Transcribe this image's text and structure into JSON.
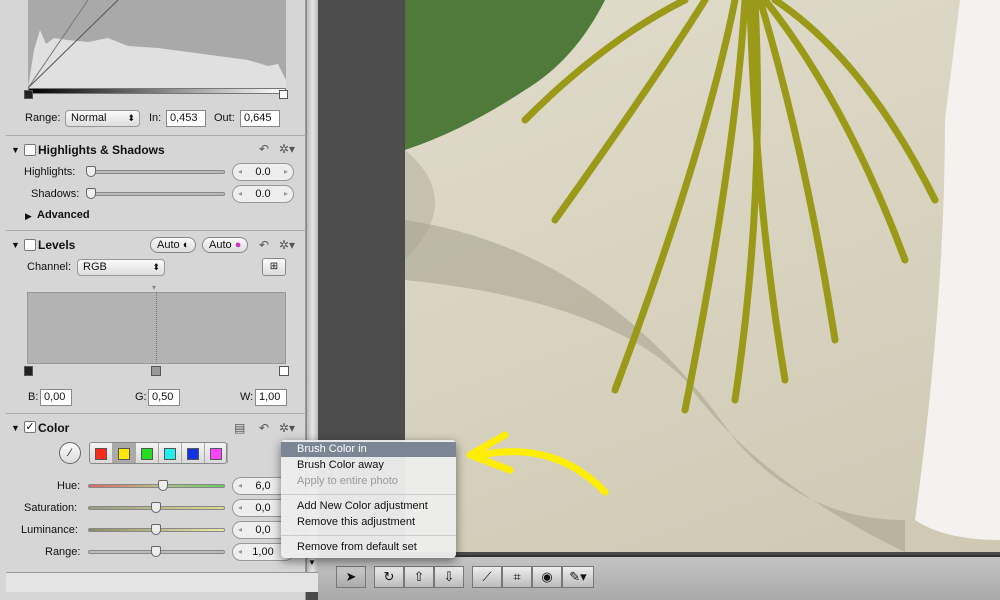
{
  "curves": {
    "range_label": "Range:",
    "range_value": "Normal",
    "in_label": "In:",
    "in_value": "0,453",
    "out_label": "Out:",
    "out_value": "0,645"
  },
  "highlights_shadows": {
    "title": "Highlights & Shadows",
    "enabled": false,
    "highlights_label": "Highlights:",
    "highlights_value": "0.0",
    "shadows_label": "Shadows:",
    "shadows_value": "0.0",
    "advanced_label": "Advanced"
  },
  "levels": {
    "title": "Levels",
    "enabled": false,
    "auto1": "Auto",
    "auto2": "Auto",
    "channel_label": "Channel:",
    "channel_value": "RGB",
    "b_label": "B:",
    "b_value": "0,00",
    "g_label": "G:",
    "g_value": "0,50",
    "w_label": "W:",
    "w_value": "1,00"
  },
  "color": {
    "title": "Color",
    "enabled": true,
    "swatches": [
      "#ff2a1a",
      "#ffe800",
      "#22dd22",
      "#22eeee",
      "#1133dd",
      "#ff44ff"
    ],
    "selected_swatch": 1,
    "hue_label": "Hue:",
    "hue_value": "6,0",
    "saturation_label": "Saturation:",
    "saturation_value": "0,0",
    "luminance_label": "Luminance:",
    "luminance_value": "0,0",
    "range_label": "Range:",
    "range_value": "1,00"
  },
  "menu": {
    "items": [
      "Brush Color in",
      "Brush Color away",
      "Apply to entire photo",
      "Add New Color adjustment",
      "Remove this adjustment",
      "Remove from default set"
    ],
    "selected": 0,
    "disabled": [
      2
    ]
  },
  "toolbar": {
    "tools": [
      "select-icon",
      "straighten-icon",
      "lift-icon",
      "stamp-icon",
      "level-icon",
      "crop-icon",
      "redeye-icon",
      "brush-icon"
    ]
  },
  "annotation_color": "#ffee00"
}
